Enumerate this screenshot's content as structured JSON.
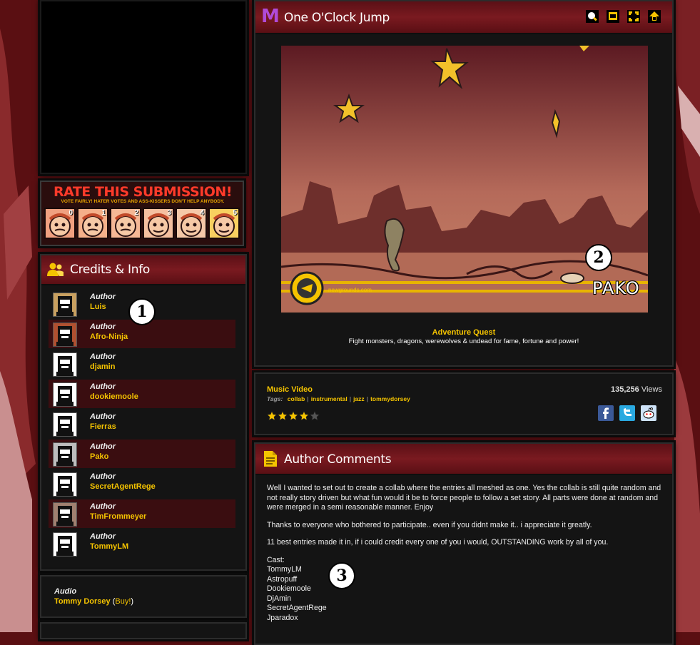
{
  "player": {
    "title": "One O'Clock Jump",
    "logo_glyph": "M",
    "ad_title": "Adventure Quest",
    "ad_tagline": "Fight monsters, dragons, werewolves & undead for fame, fortune and power!",
    "watermark": "newgrounds.com",
    "signature": "PAKO",
    "toolbar_icons": [
      "search-icon",
      "popout-icon",
      "fullscreen-icon",
      "share-icon"
    ]
  },
  "rating": {
    "headline": "RATE THIS SUBMISSION!",
    "subline": "VOTE FAIRLY! HATER VOTES AND ASS-KISSERS DON'T HELP ANYBODY.",
    "scores": [
      "0",
      "1",
      "2",
      "3",
      "4",
      "5"
    ]
  },
  "credits": {
    "title": "Credits & Info",
    "authors": [
      {
        "role": "Author",
        "name": "Luis"
      },
      {
        "role": "Author",
        "name": "Afro-Ninja"
      },
      {
        "role": "Author",
        "name": "djamin"
      },
      {
        "role": "Author",
        "name": "dookiemoole"
      },
      {
        "role": "Author",
        "name": "Fierras"
      },
      {
        "role": "Author",
        "name": "Pako"
      },
      {
        "role": "Author",
        "name": "SecretAgentRege"
      },
      {
        "role": "Author",
        "name": "TimFrommeyer"
      },
      {
        "role": "Author",
        "name": "TommyLM"
      }
    ],
    "audio_label": "Audio",
    "audio_artist": "Tommy Dorsey",
    "audio_buy_open": "(",
    "audio_buy": "Buy!",
    "audio_buy_close": ")"
  },
  "info": {
    "category": "Music Video",
    "tags_label": "Tags:",
    "tags": [
      "collab",
      "instrumental",
      "jazz",
      "tommydorsey"
    ],
    "views_count": "135,256",
    "views_label": "Views",
    "rating_stars": 4,
    "rating_max": 5,
    "share_icons": [
      "facebook-icon",
      "twitter-icon",
      "reddit-icon"
    ]
  },
  "comments": {
    "title": "Author Comments",
    "paragraphs": [
      "Well I wanted to set out to create a collab where the entries all meshed as one. Yes the collab is still quite random and not really story driven but what fun would it be to force people to follow a set story. All parts were done at random and were merged in a semi reasonable manner. Enjoy",
      "Thanks to everyone who bothered to participate.. even if you didnt make it.. i appreciate it greatly.",
      "11 best entries made it in, if i could credit every one of you i would, OUTSTANDING work by all of you."
    ],
    "cast_label": "Cast:",
    "cast": [
      "TommyLM",
      "Astropuff",
      "Dookiemoole",
      "DjAmin",
      "SecretAgentRege",
      "Jparadox"
    ]
  },
  "markers": [
    "1",
    "2",
    "3"
  ],
  "colors": {
    "accent": "#f5c400",
    "panel": "#141414",
    "header": "#6b151b",
    "background": "#5a0f12"
  }
}
